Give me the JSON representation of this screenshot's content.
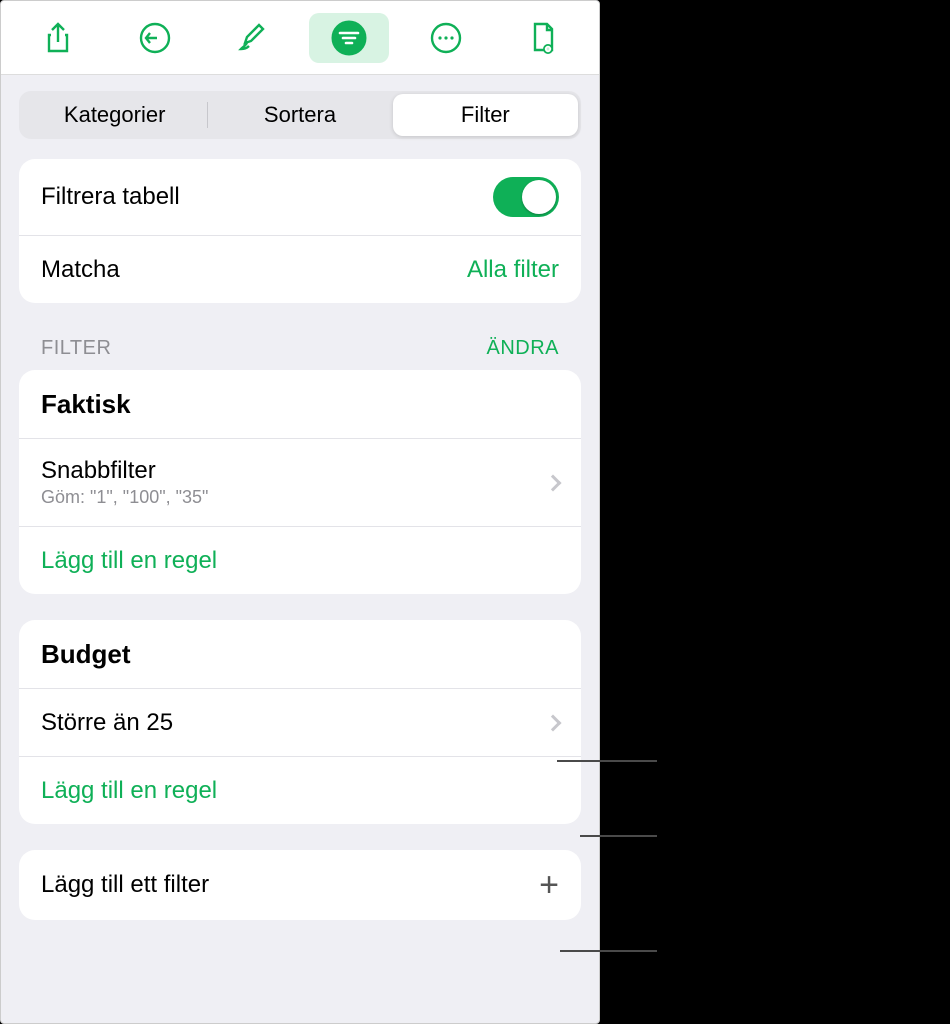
{
  "toolbar": {
    "icons": [
      "share-icon",
      "undo-icon",
      "brush-icon",
      "filter-icon",
      "more-icon",
      "document-icon"
    ]
  },
  "tabs": {
    "items": [
      "Kategorier",
      "Sortera",
      "Filter"
    ],
    "active_index": 2
  },
  "filterTable": {
    "label": "Filtrera tabell",
    "toggle_on": true
  },
  "match": {
    "label": "Matcha",
    "value": "Alla filter"
  },
  "sectionHeader": {
    "title": "FILTER",
    "edit": "ÄNDRA"
  },
  "groups": [
    {
      "title": "Faktisk",
      "rules": [
        {
          "label": "Snabbfilter",
          "sub": "Göm: \"1\", \"100\", \"35\""
        }
      ],
      "add_rule": "Lägg till en regel"
    },
    {
      "title": "Budget",
      "rules": [
        {
          "label": "Större än 25"
        }
      ],
      "add_rule": "Lägg till en regel"
    }
  ],
  "addFilter": {
    "label": "Lägg till ett filter"
  }
}
